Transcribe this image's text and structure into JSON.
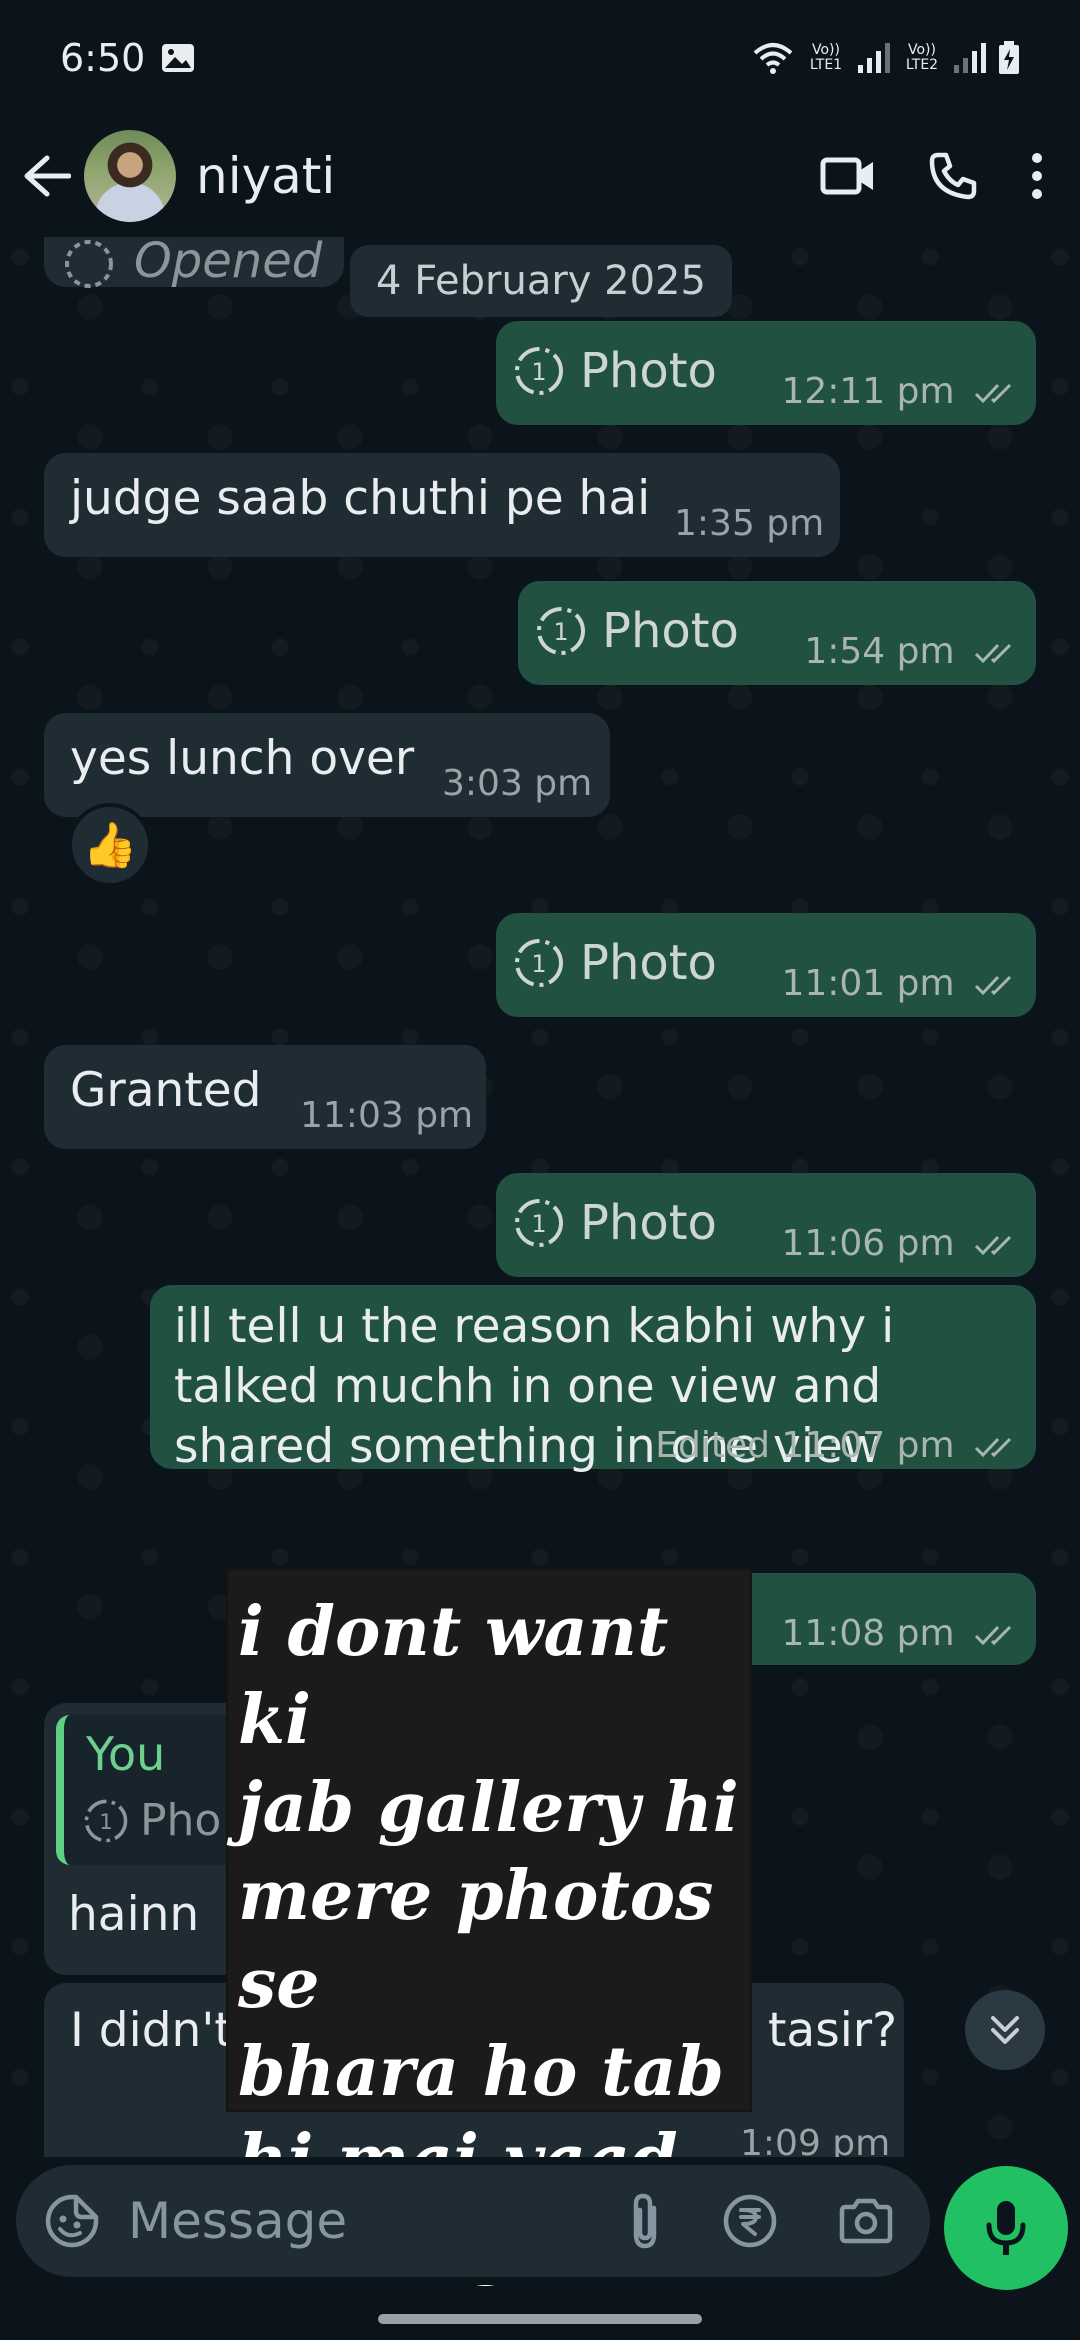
{
  "status_bar": {
    "time": "6:50",
    "sim1_label": "Vo)) LTE1",
    "sim2_label": "Vo)) LTE2"
  },
  "header": {
    "contact_name": "niyati",
    "icons": [
      "back-arrow-icon",
      "avatar",
      "video-call-icon",
      "phone-icon",
      "more-options-icon"
    ]
  },
  "chat": {
    "opened_label": "Opened",
    "date_chip": "4 February 2025",
    "messages": [
      {
        "direction": "out",
        "type": "view-once-photo",
        "label": "Photo",
        "time": "12:11 pm"
      },
      {
        "direction": "in",
        "text": "judge saab chuthi pe hai",
        "time": "1:35 pm"
      },
      {
        "direction": "out",
        "type": "view-once-photo",
        "label": "Photo",
        "time": "1:54 pm"
      },
      {
        "direction": "in",
        "text": "yes lunch over",
        "time": "3:03 pm",
        "reaction": "👍"
      },
      {
        "direction": "out",
        "type": "view-once-photo",
        "label": "Photo",
        "time": "11:01 pm"
      },
      {
        "direction": "in",
        "text": "Granted",
        "time": "11:03 pm"
      },
      {
        "direction": "out",
        "type": "view-once-photo",
        "label": "Photo",
        "time": "11:06 pm"
      },
      {
        "direction": "out",
        "text": "ill tell u the reason kabhi why i talked muchh in one view and shared something in one view",
        "time": "Edited 11:07 pm"
      },
      {
        "direction": "out",
        "text": "",
        "time": "11:08 pm"
      },
      {
        "direction": "in",
        "quote_author": "You",
        "quote_label": "Pho",
        "text": "hainn",
        "time": ""
      },
      {
        "direction": "in",
        "text_left": "I didn't",
        "text_right": "tasir?",
        "time_partial": "1:09 pm"
      }
    ]
  },
  "sticker_note": {
    "text": "i dont want ki\njab gallery hi\nmere photos se\nbhara ho tab\nhi mai yaad\naau logo ko"
  },
  "composer": {
    "placeholder": "Message"
  },
  "colors": {
    "background": "#0b141a",
    "incoming_bubble": "#1f2c34",
    "outgoing_bubble": "#215140",
    "mic_button": "#21c063",
    "read_ticks": "#a8b5b0"
  }
}
